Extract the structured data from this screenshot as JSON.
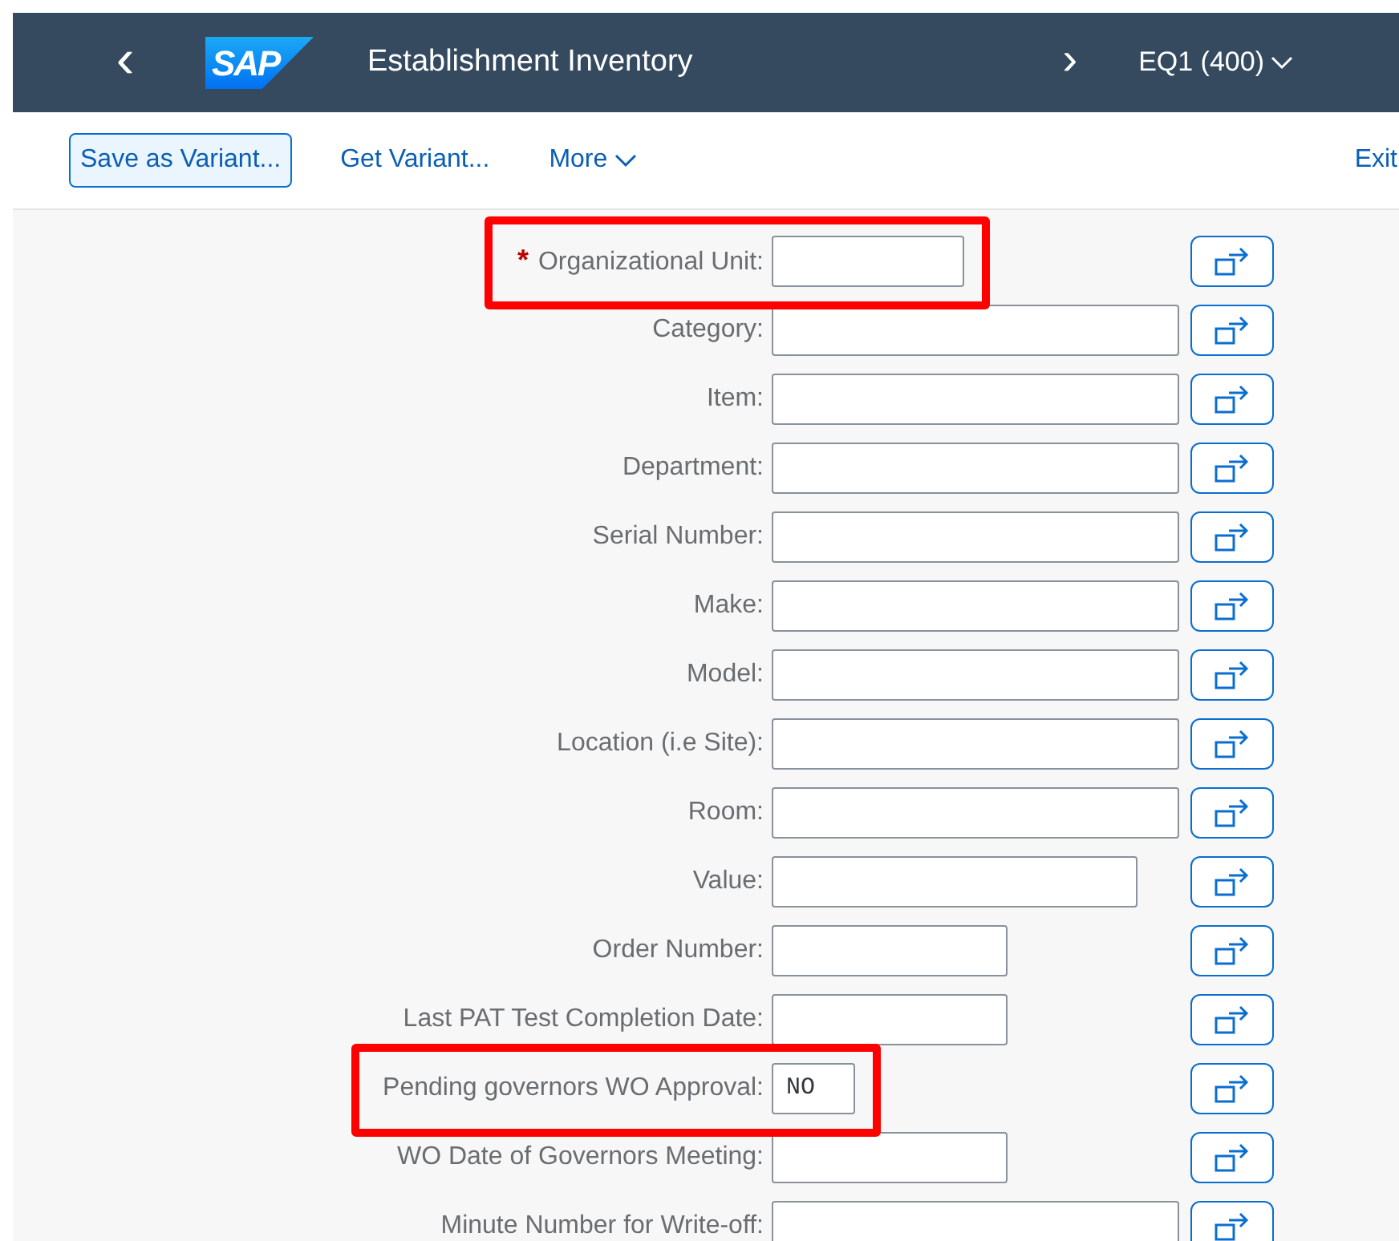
{
  "shell": {
    "back": "‹",
    "logo": "SAP",
    "title": "Establishment Inventory",
    "forward": "›",
    "system": "EQ1 (400)"
  },
  "toolbar": {
    "buttons": [
      {
        "label": "Save as Variant...",
        "kind": "emphasized"
      },
      {
        "label": "Get Variant...",
        "kind": "transparent"
      }
    ],
    "more": "More",
    "exit": "Exit"
  },
  "fields": [
    {
      "required_mark": "*",
      "label": "Organizational Unit:",
      "kind": "s",
      "highlighted": true
    },
    {
      "label": "Category:",
      "kind": "xl",
      "highlighted": false
    },
    {
      "label": "Item:",
      "kind": "xl",
      "highlighted": false
    },
    {
      "label": "Department:",
      "kind": "xl",
      "highlighted": false
    },
    {
      "label": "Serial Number:",
      "kind": "xl",
      "highlighted": false
    },
    {
      "label": "Make:",
      "kind": "xl",
      "highlighted": false
    },
    {
      "label": "Model:",
      "kind": "xl",
      "highlighted": false
    },
    {
      "label": "Location (i.e Site):",
      "kind": "xl",
      "highlighted": false
    },
    {
      "label": "Room:",
      "kind": "xl",
      "highlighted": false
    },
    {
      "label": "Value:",
      "kind": "l",
      "highlighted": false
    },
    {
      "label": "Order Number:",
      "kind": "m",
      "highlighted": false
    },
    {
      "label": "Last PAT Test Completion Date:",
      "kind": "m",
      "highlighted": false
    },
    {
      "label": "Pending governors WO Approval:",
      "value": "NO",
      "kind": "xs",
      "highlighted": true
    },
    {
      "label": "WO Date of Governors Meeting:",
      "kind": "m",
      "highlighted": false
    },
    {
      "label": "Minute Number for Write-off:",
      "kind": "xl",
      "highlighted": false
    }
  ]
}
